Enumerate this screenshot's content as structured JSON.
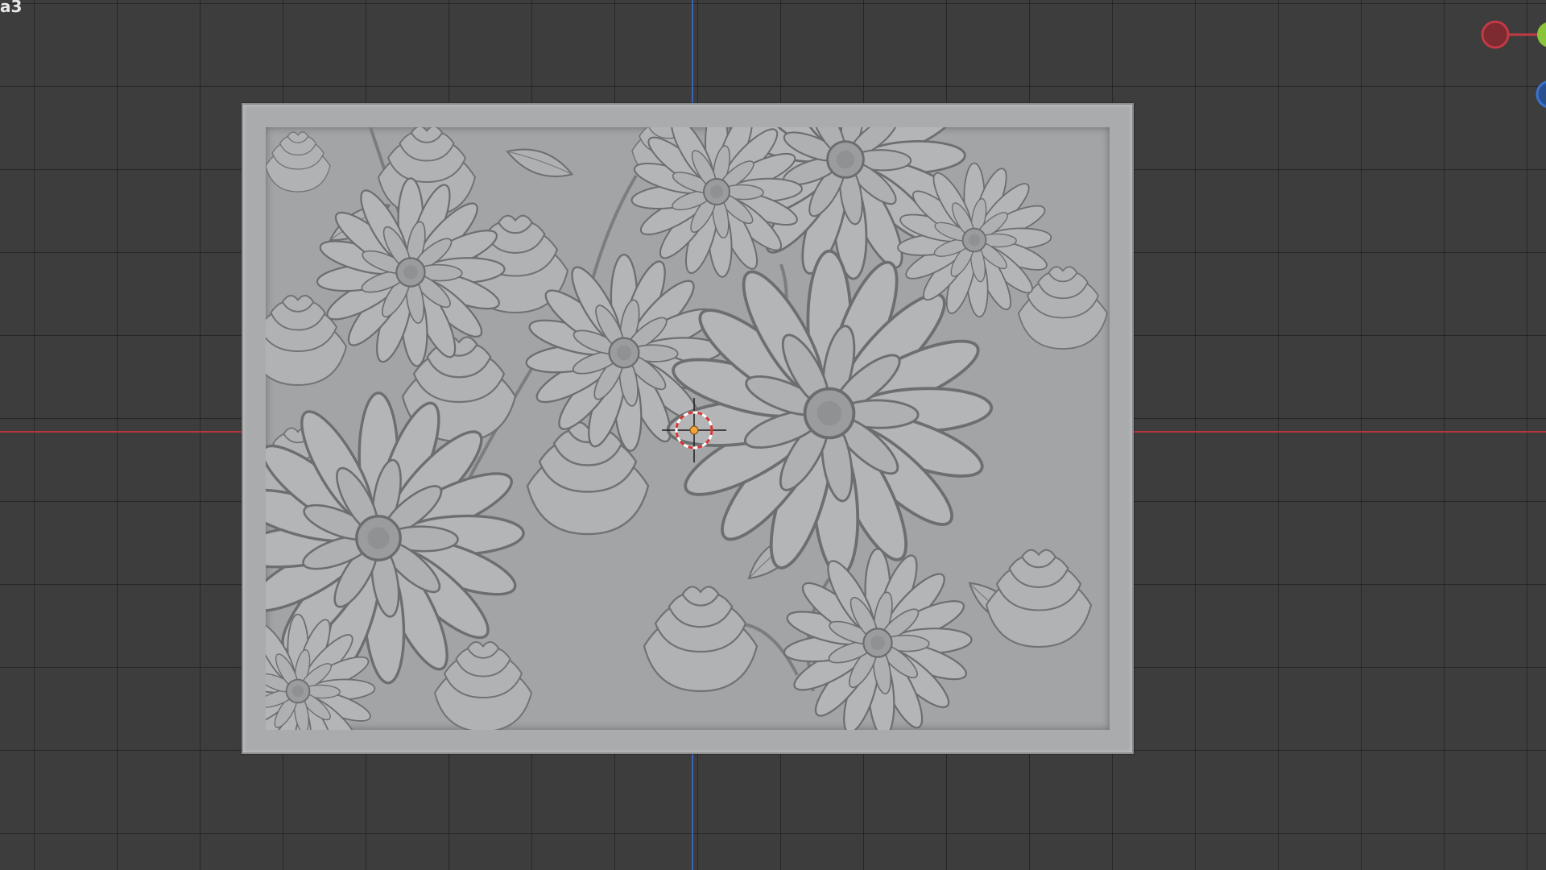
{
  "viewport": {
    "label": "a3"
  },
  "colors": {
    "background": "#3d3d3d",
    "grid_line": "#2a2a2a",
    "axis_x": "#b5363e",
    "axis_y": "#3a63b5",
    "panel": "#a9abac",
    "relief": "#a2a4a5",
    "cursor_ring_red": "#d83434",
    "cursor_ring_white": "#ffffff",
    "origin_dot": "#f2a33a",
    "gizmo_x": "#c33a44",
    "gizmo_y": "#8ac43a",
    "gizmo_z": "#3a72d0"
  },
  "scene": {
    "object": "floral-relief-panel",
    "pattern_icon": "chrysanthemum-relief-icon"
  },
  "gizmo": {
    "x_icon": "x-axis-handle-icon",
    "y_icon": "y-axis-handle-icon",
    "z_icon": "z-axis-handle-icon"
  }
}
